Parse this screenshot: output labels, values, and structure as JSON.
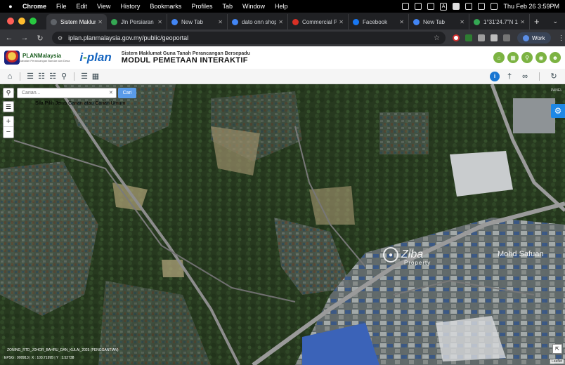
{
  "os_menubar": {
    "app_name": "Chrome",
    "menus": [
      "File",
      "Edit",
      "View",
      "History",
      "Bookmarks",
      "Profiles",
      "Tab",
      "Window",
      "Help"
    ],
    "clock": "Thu Feb 26  3:59PM",
    "icon_a": "A"
  },
  "browser": {
    "tabs": [
      {
        "label": "Sistem Maklumat",
        "color": "#5f6368",
        "active": true
      },
      {
        "label": "Jln Persiaran T",
        "color": "#34a853"
      },
      {
        "label": "New Tab",
        "color": "#4285f4"
      },
      {
        "label": "dato onn shop",
        "color": "#4285f4"
      },
      {
        "label": "Commercial Pr",
        "color": "#d93025"
      },
      {
        "label": "Facebook",
        "color": "#1877f2"
      },
      {
        "label": "New Tab",
        "color": "#4285f4"
      },
      {
        "label": "1°31'24.7\"N 1",
        "color": "#34a853"
      }
    ],
    "url": "iplan.planmalaysia.gov.my/public/geoportal",
    "work_label": "Work"
  },
  "site": {
    "org_name": "PLANMalaysia",
    "org_sub": "Jabatan Perancangan Bandar dan Desa",
    "iplan_i": "i",
    "iplan_dash": "-",
    "iplan_rest": "plan",
    "subtitle": "Sistem Maklumat Guna Tanah Perancangan Bersepadu",
    "title": "MODUL PEMETAAN INTERAKTIF"
  },
  "map": {
    "search_placeholder": "Carian...",
    "search_button": "Cari",
    "hint": "Sila Pilih Jenis Carian atau Carian Umum",
    "panel_label": "PANEL",
    "watermark_main": "Ziba",
    "watermark_sub": "Property",
    "credit": "Mohd Safuan",
    "overlay_label": "ZONING_RTD_JOHOR_BAHRU_DAN_KULAI_2025 (PENGGANTIAN)",
    "coords": "EPSG : 900913 | X : 103.71995 | Y : 1.52738",
    "attribution": "Leaflet"
  },
  "colors": {
    "accent_green": "#7cb342",
    "accent_blue": "#1e88e5"
  }
}
